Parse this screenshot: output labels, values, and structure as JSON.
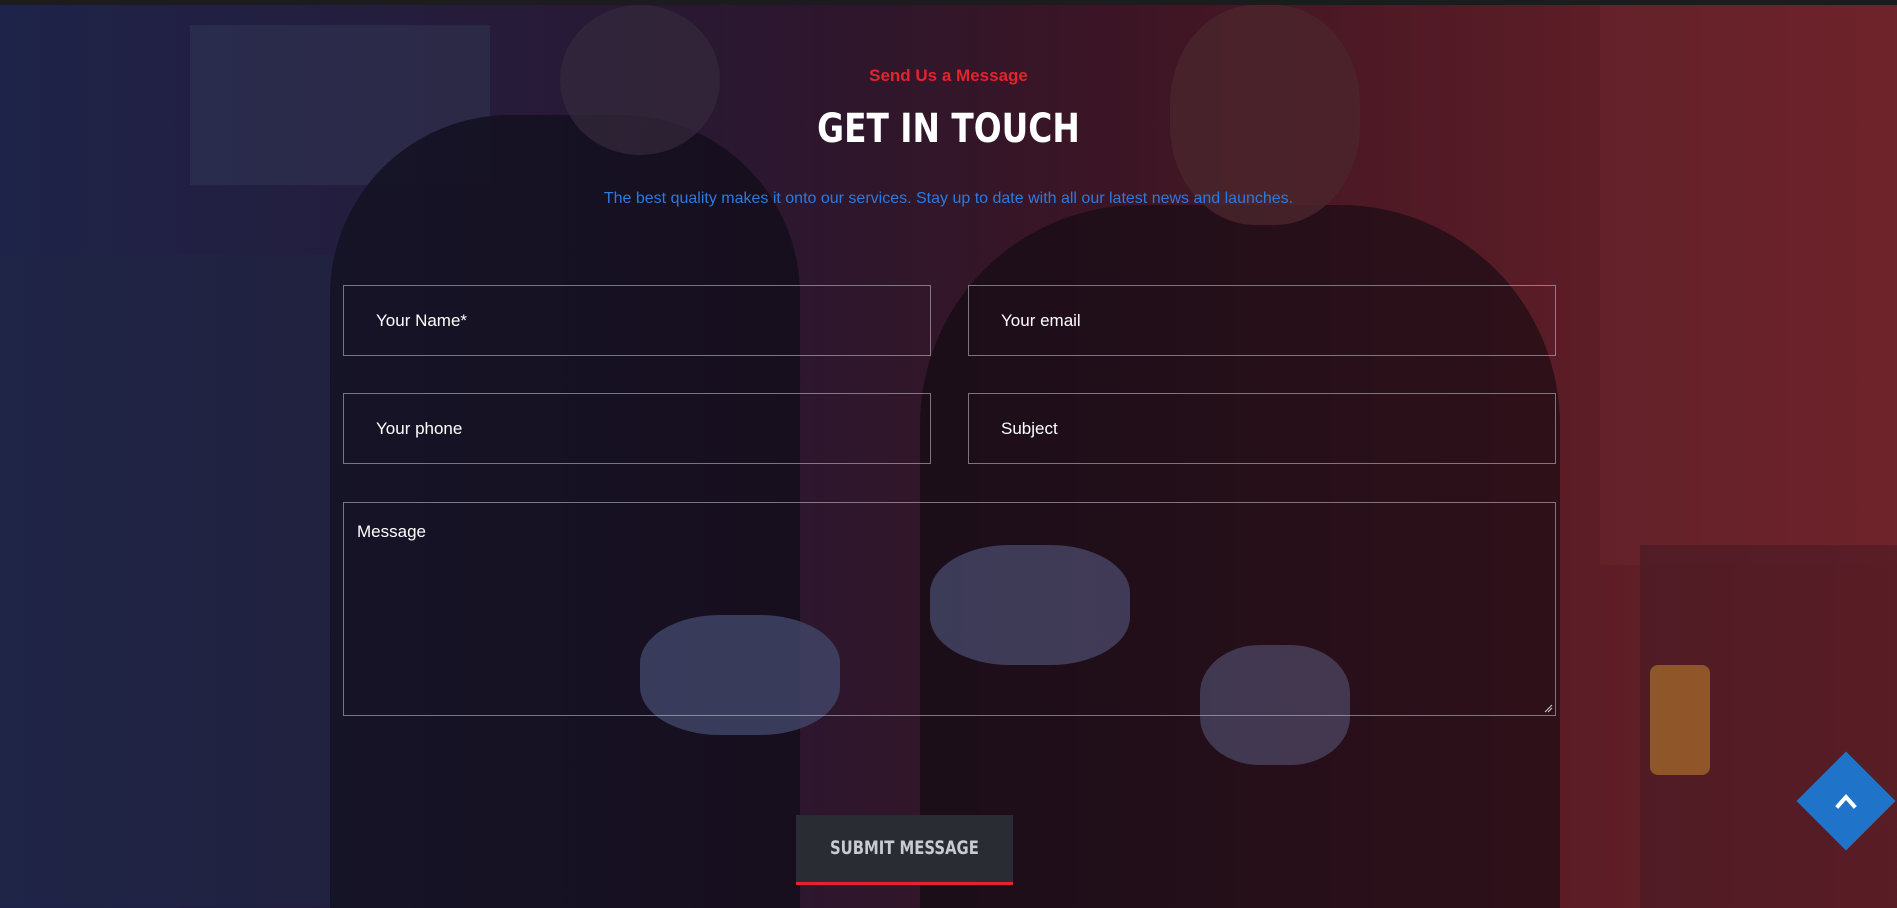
{
  "section": {
    "eyebrow": "Send Us a Message",
    "title": "GET IN TOUCH",
    "subtitle": "The best quality makes it onto our services. Stay up to date with all our latest news and launches."
  },
  "form": {
    "name_placeholder": "Your Name*",
    "email_placeholder": "Your email",
    "phone_placeholder": "Your phone",
    "subject_placeholder": "Subject",
    "message_placeholder": "Message",
    "submit_label": "SUBMIT MESSAGE"
  },
  "icons": {
    "scroll_top": "chevron-up-icon"
  },
  "colors": {
    "accent_red": "#e3232d",
    "accent_blue": "#1f73c9",
    "subtitle_blue": "#2b7ae0",
    "button_bg": "#2a2c33"
  }
}
